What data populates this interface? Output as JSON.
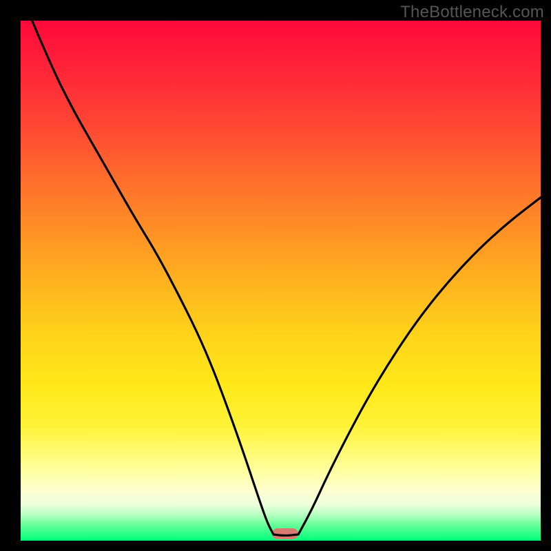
{
  "watermark": "TheBottleneck.com",
  "marker": {
    "x_frac": 0.509,
    "y_frac": 0.987
  },
  "chart_data": {
    "type": "line",
    "title": "",
    "xlabel": "",
    "ylabel": "",
    "xlim": [
      0,
      1
    ],
    "ylim": [
      0,
      1
    ],
    "notes": "V-shaped bottleneck curve over vertical red→green gradient. Axes unlabeled; values are normalized fractions of plot width/height. marker sits at curve minimum.",
    "series": [
      {
        "name": "left-branch",
        "x": [
          0.022,
          0.06,
          0.1,
          0.14,
          0.18,
          0.22,
          0.26,
          0.3,
          0.34,
          0.37,
          0.4,
          0.43,
          0.455,
          0.474,
          0.486
        ],
        "y": [
          1.0,
          0.91,
          0.83,
          0.76,
          0.69,
          0.62,
          0.555,
          0.48,
          0.4,
          0.33,
          0.25,
          0.165,
          0.09,
          0.035,
          0.012
        ]
      },
      {
        "name": "flat-bottom",
        "x": [
          0.486,
          0.5,
          0.515,
          0.534
        ],
        "y": [
          0.012,
          0.01,
          0.01,
          0.012
        ]
      },
      {
        "name": "right-branch",
        "x": [
          0.534,
          0.56,
          0.59,
          0.625,
          0.665,
          0.71,
          0.76,
          0.815,
          0.875,
          0.935,
          1.0
        ],
        "y": [
          0.012,
          0.06,
          0.125,
          0.195,
          0.27,
          0.345,
          0.42,
          0.49,
          0.555,
          0.61,
          0.66
        ]
      }
    ]
  }
}
